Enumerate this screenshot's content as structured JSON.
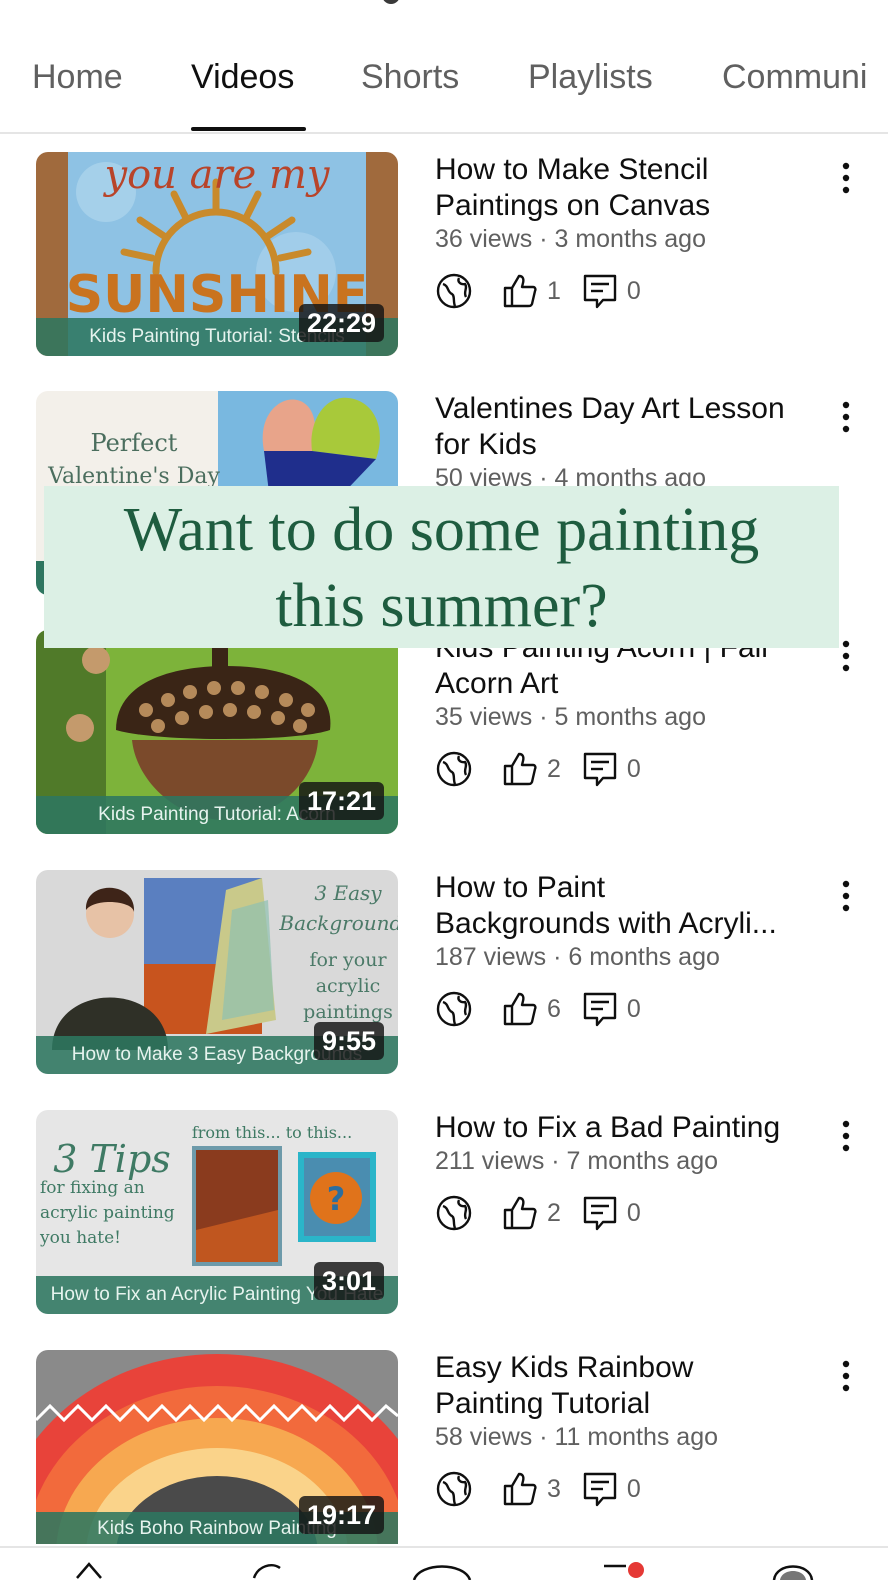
{
  "tabs": [
    {
      "label": "Home",
      "active": false
    },
    {
      "label": "Videos",
      "active": true
    },
    {
      "label": "Shorts",
      "active": false
    },
    {
      "label": "Playlists",
      "active": false
    },
    {
      "label": "Communi",
      "active": false
    }
  ],
  "banner": {
    "line1": "Want to do some painting",
    "line2": "this summer?"
  },
  "colors": {
    "accent_green": "#1e5c3f",
    "banner_bg": "#dcf0e5",
    "caption_bg": "#2e7660",
    "secondary_text": "#606060"
  },
  "videos": [
    {
      "title_line1": "How to Make Stencil",
      "title_line2": "Paintings on Canvas",
      "meta": "36 views · 3 months ago",
      "likes": "1",
      "comments": "0",
      "duration": "22:29",
      "caption": "Kids Painting Tutorial: Stencils",
      "thumb_text1": "you are my",
      "thumb_text2": "SUNSHINE"
    },
    {
      "title_line1": "Valentines Day Art Lesson",
      "title_line2": "for Kids",
      "meta": "50 views · 4 months ago",
      "thumb_text1": "Perfect",
      "thumb_text2": "Valentine's Day"
    },
    {
      "title_line1": "Kids Painting Acorn | Fall",
      "title_line2": "Acorn Art",
      "meta": "35 views · 5 months ago",
      "likes": "2",
      "comments": "0",
      "duration": "17:21",
      "caption": "Kids Painting Tutorial: Acorn"
    },
    {
      "title_line1": "How to Paint",
      "title_line2": "Backgrounds with Acryli...",
      "meta": "187 views · 6 months ago",
      "likes": "6",
      "comments": "0",
      "duration": "9:55",
      "caption": "How to Make 3 Easy Backgrounds",
      "thumb_text1": "3 Easy",
      "thumb_text2": "Backgrounds",
      "thumb_text3": "for your",
      "thumb_text4": "acrylic",
      "thumb_text5": "paintings"
    },
    {
      "title_line1": "How to Fix a Bad Painting",
      "meta": "211 views · 7 months ago",
      "likes": "2",
      "comments": "0",
      "duration": "3:01",
      "caption": "How to Fix an Acrylic Painting You Hate",
      "thumb_text1": "3 Tips",
      "thumb_text2": "for fixing an",
      "thumb_text3": "acrylic painting",
      "thumb_text4": "you hate!",
      "thumb_text5": "from this... to this..."
    },
    {
      "title_line1": "Easy Kids Rainbow",
      "title_line2": "Painting Tutorial",
      "meta": "58 views · 11 months ago",
      "likes": "3",
      "comments": "0",
      "duration": "19:17",
      "caption": "Kids Boho Rainbow Painting"
    }
  ]
}
